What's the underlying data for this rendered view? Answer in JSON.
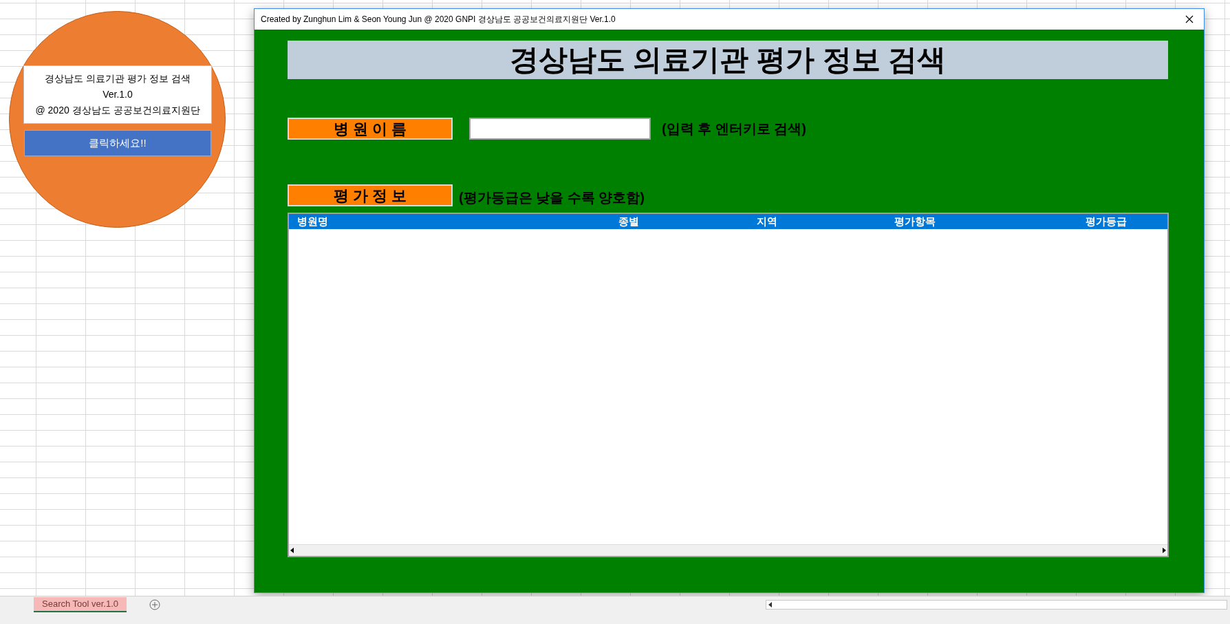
{
  "sheet": {
    "shape": {
      "info_lines": [
        "경상남도 의료기관 평가 정보 검색",
        "Ver.1.0",
        "@ 2020 경상남도 공공보건의료지원단"
      ],
      "button": "클릭하세요!!"
    },
    "tabs": [
      {
        "label": "Search Tool ver.1.0",
        "selected": true
      }
    ]
  },
  "dialog": {
    "title": "Created by Zunghun Lim & Seon Young Jun @ 2020 GNPI 경상남도 공공보건의료지원단 Ver.1.0",
    "heading": "경상남도 의료기관 평가 정보 검색",
    "search": {
      "label": "병 원 이 름",
      "hint": "(입력 후 엔터키로 검색)"
    },
    "results": {
      "label": "평 가 정 보",
      "hint": "(평가등급은 낮을 수록 양호함)",
      "columns": [
        "병원명",
        "종별",
        "지역",
        "평가항목",
        "평가등급"
      ]
    }
  }
}
